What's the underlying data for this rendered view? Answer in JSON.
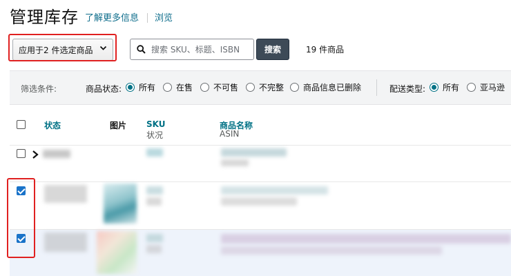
{
  "header": {
    "title": "管理库存",
    "learn_more": "了解更多信息",
    "browse": "浏览"
  },
  "toolbar": {
    "bulk_action_label": "应用于2 件选定商品",
    "search_placeholder": "搜索 SKU、标题、ISBN",
    "search_button": "搜索",
    "result_count": "19 件商品"
  },
  "filters": {
    "label": "筛选条件:",
    "status_group": {
      "label": "商品状态:",
      "options": [
        "所有",
        "在售",
        "不可售",
        "不完整",
        "商品信息已删除"
      ],
      "selected": "所有"
    },
    "fulfillment_group": {
      "label": "配送类型:",
      "options": [
        "所有",
        "亚马逊"
      ],
      "selected": "所有"
    }
  },
  "table": {
    "columns": {
      "status": "状态",
      "image": "图片",
      "sku": "SKU",
      "sku_sub": "状况",
      "name": "商品名称",
      "name_sub": "ASIN"
    },
    "rows": [
      {
        "checked": false
      },
      {
        "checked": true
      },
      {
        "checked": true
      }
    ]
  },
  "colors": {
    "accent": "#007185",
    "highlight": "#e02020",
    "search_button_bg": "#3d4a57",
    "checkbox_checked": "#1a73c9"
  }
}
